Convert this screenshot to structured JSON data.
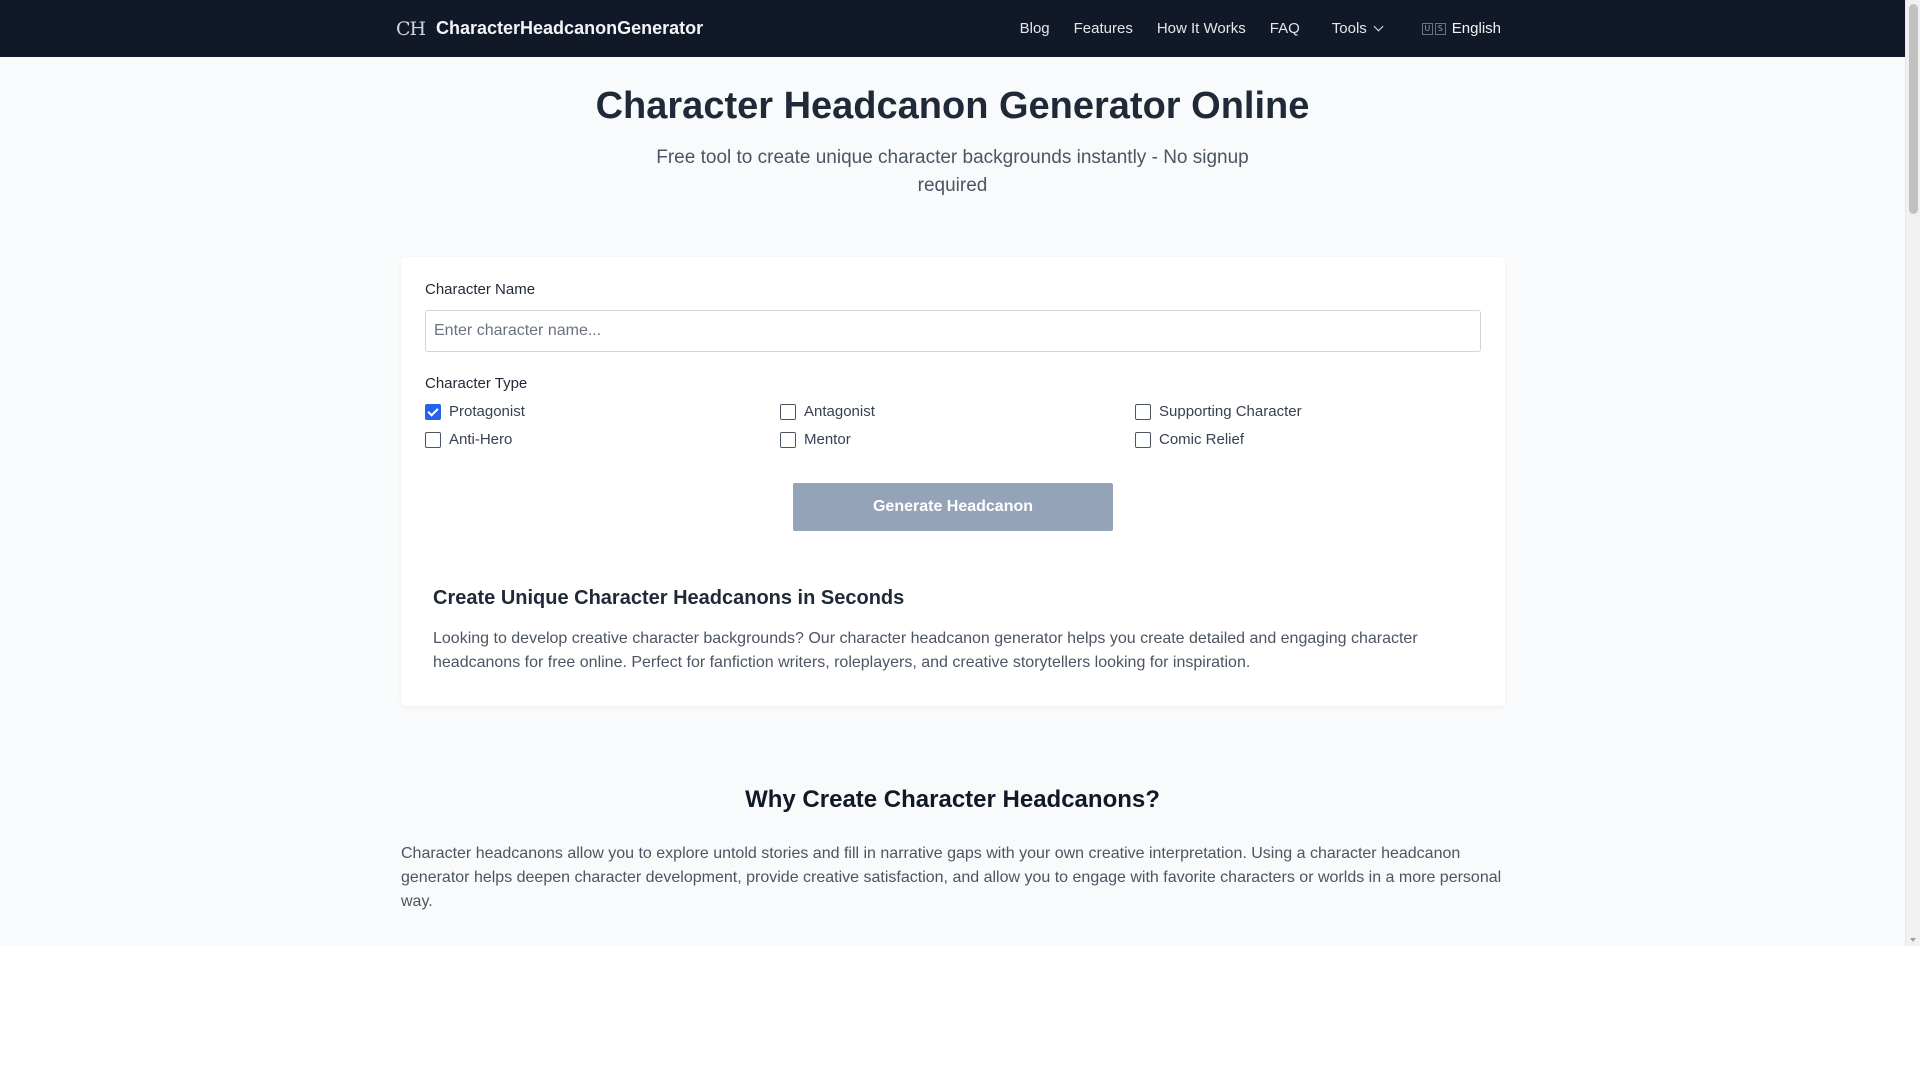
{
  "header": {
    "logo_text": "CH",
    "brand_name": "CharacterHeadcanonGenerator",
    "nav": [
      "Blog",
      "Features",
      "How It Works",
      "FAQ"
    ],
    "tools_label": "Tools",
    "flag_letters": [
      "U",
      "S"
    ],
    "language": "English",
    "background": "#111827"
  },
  "hero": {
    "title": "Character Headcanon Generator Online",
    "subtitle": "Free tool to create unique character backgrounds instantly - No signup required"
  },
  "form": {
    "name_label": "Character Name",
    "name_placeholder": "Enter character name...",
    "name_value": "",
    "type_label": "Character Type",
    "options": [
      {
        "label": "Protagonist",
        "checked": true
      },
      {
        "label": "Antagonist",
        "checked": false
      },
      {
        "label": "Supporting Character",
        "checked": false
      },
      {
        "label": "Anti-Hero",
        "checked": false
      },
      {
        "label": "Mentor",
        "checked": false
      },
      {
        "label": "Comic Relief",
        "checked": false
      }
    ],
    "generate_label": "Generate Headcanon",
    "checkbox_color": "#2563eb",
    "button_color": "#94a3b8"
  },
  "intro": {
    "heading": "Create Unique Character Headcanons in Seconds",
    "text": "Looking to develop creative character backgrounds? Our character headcanon generator helps you create detailed and engaging character headcanons for free online. Perfect for fanfiction writers, roleplayers, and creative storytellers looking for inspiration."
  },
  "why": {
    "heading": "Why Create Character Headcanons?",
    "text": "Character headcanons allow you to explore untold stories and fill in narrative gaps with your own creative interpretation. Using a character headcanon generator helps deepen character development, provide creative satisfaction, and allow you to engage with favorite characters or worlds in a more personal way."
  }
}
